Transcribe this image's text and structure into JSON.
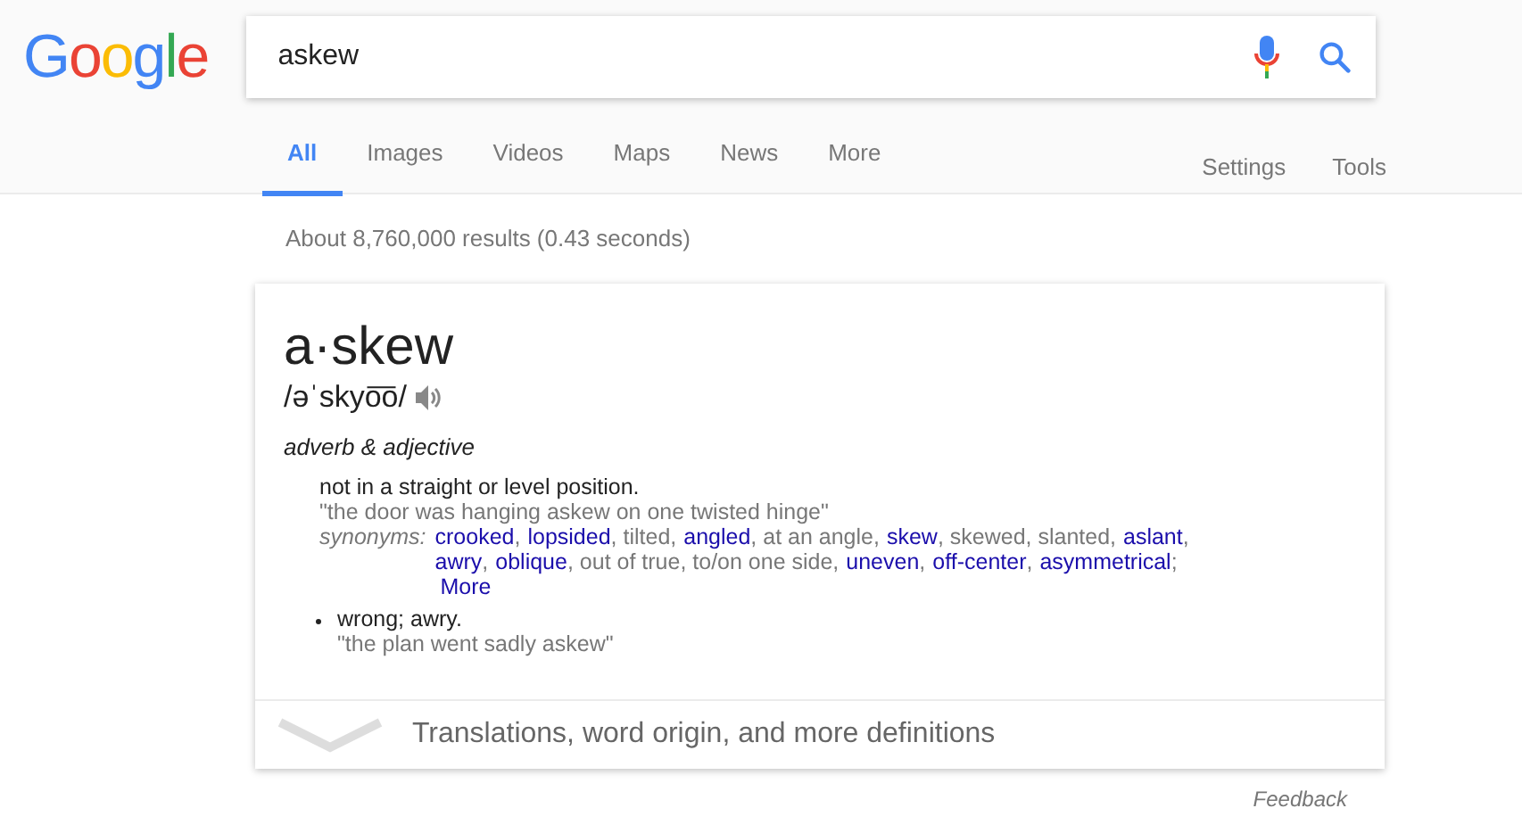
{
  "logo": [
    {
      "text": "G",
      "color": "#4285f4"
    },
    {
      "text": "o",
      "color": "#ea4335"
    },
    {
      "text": "o",
      "color": "#fbbc05"
    },
    {
      "text": "g",
      "color": "#4285f4"
    },
    {
      "text": "l",
      "color": "#34a853"
    },
    {
      "text": "e",
      "color": "#ea4335"
    }
  ],
  "search": {
    "value": "askew"
  },
  "tabs": [
    {
      "label": "All",
      "selected": true
    },
    {
      "label": "Images",
      "selected": false
    },
    {
      "label": "Videos",
      "selected": false
    },
    {
      "label": "Maps",
      "selected": false
    },
    {
      "label": "News",
      "selected": false
    },
    {
      "label": "More",
      "selected": false
    }
  ],
  "tools": [
    "Settings",
    "Tools"
  ],
  "result_stats": "About 8,760,000 results (0.43 seconds)",
  "card": {
    "word": "a·skew",
    "pronunciation": "/əˈskyo͞o/",
    "part_of_speech": "adverb & adjective",
    "senses": [
      {
        "definition": "not in a straight or level position.",
        "example": "\"the door was hanging askew on one twisted hinge\"",
        "bullet": false,
        "synonyms_label": "synonyms:",
        "synonyms": [
          {
            "kind": "link",
            "text": "crooked"
          },
          {
            "kind": "plain",
            "text": ","
          },
          {
            "kind": "link",
            "text": "lopsided"
          },
          {
            "kind": "plain",
            "text": ", tilted,"
          },
          {
            "kind": "link",
            "text": "angled"
          },
          {
            "kind": "plain",
            "text": ", at an angle,"
          },
          {
            "kind": "link",
            "text": "skew"
          },
          {
            "kind": "plain",
            "text": ", skewed, slanted,"
          },
          {
            "kind": "link",
            "text": "aslant"
          },
          {
            "kind": "plain",
            "text": ","
          },
          {
            "kind": "link",
            "text": "awry"
          },
          {
            "kind": "plain",
            "text": ","
          },
          {
            "kind": "link",
            "text": "oblique"
          },
          {
            "kind": "plain",
            "text": ", out of true, to/on one side,"
          },
          {
            "kind": "link",
            "text": "uneven"
          },
          {
            "kind": "plain",
            "text": ","
          },
          {
            "kind": "link",
            "text": "off-center"
          },
          {
            "kind": "plain",
            "text": ","
          },
          {
            "kind": "link",
            "text": "asymmetrical"
          },
          {
            "kind": "plain",
            "text": ";"
          },
          {
            "kind": "more",
            "text": "More"
          }
        ]
      },
      {
        "definition": "wrong; awry.",
        "example": "\"the plan went sadly askew\"",
        "bullet": true
      }
    ],
    "more_definitions": "Translations, word origin, and more definitions"
  },
  "feedback": "Feedback"
}
